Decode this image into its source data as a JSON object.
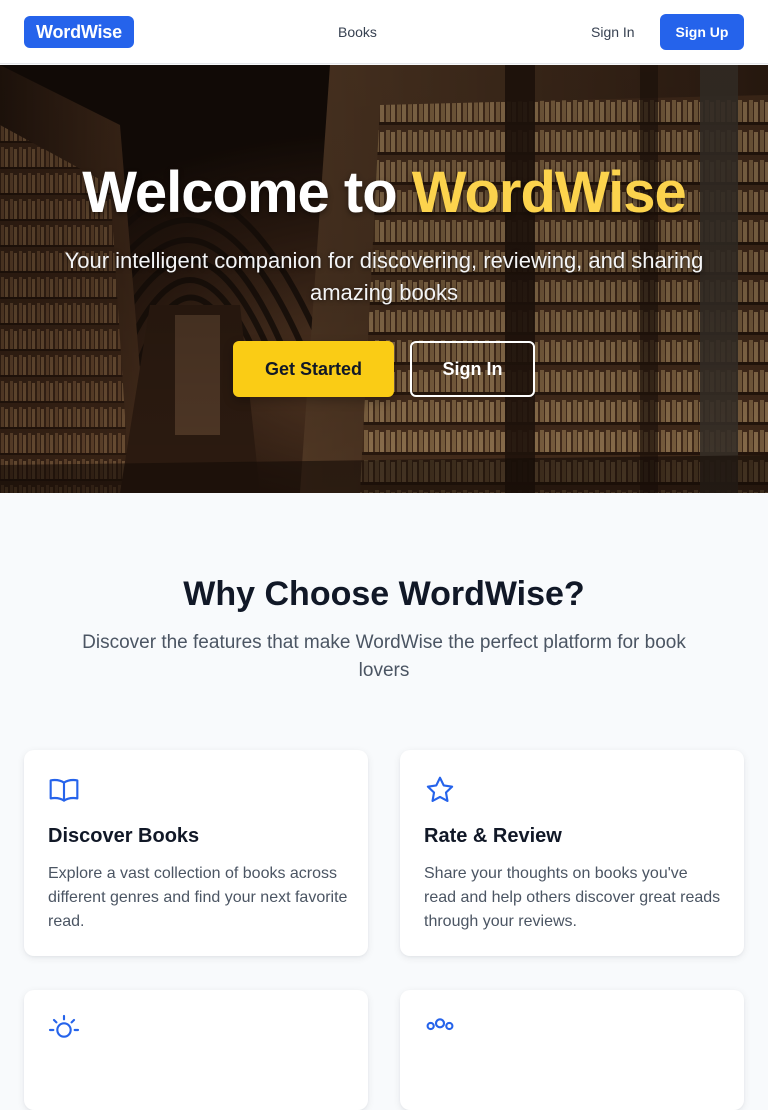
{
  "header": {
    "logo": "WordWise",
    "nav_books": "Books",
    "nav_signin": "Sign In",
    "signup_label": "Sign Up"
  },
  "hero": {
    "title_prefix": "Welcome to ",
    "title_accent": "WordWise",
    "subtitle": "Your intelligent companion for discovering, reviewing, and sharing amazing books",
    "primary_cta": "Get Started",
    "secondary_cta": "Sign In"
  },
  "features": {
    "title": "Why Choose WordWise?",
    "subtitle": "Discover the features that make WordWise the perfect platform for book lovers",
    "cards": [
      {
        "icon": "book-open-icon",
        "title": "Discover Books",
        "text": "Explore a vast collection of books across different genres and find your next favorite read."
      },
      {
        "icon": "star-icon",
        "title": "Rate & Review",
        "text": "Share your thoughts on books you've read and help others discover great reads through your reviews."
      },
      {
        "icon": "lightbulb-icon"
      },
      {
        "icon": "users-icon"
      }
    ]
  },
  "colors": {
    "brand": "#2563eb",
    "accent_yellow": "#facc15",
    "title_yellow": "#fcd34d",
    "page_bg": "#f8fafc"
  }
}
